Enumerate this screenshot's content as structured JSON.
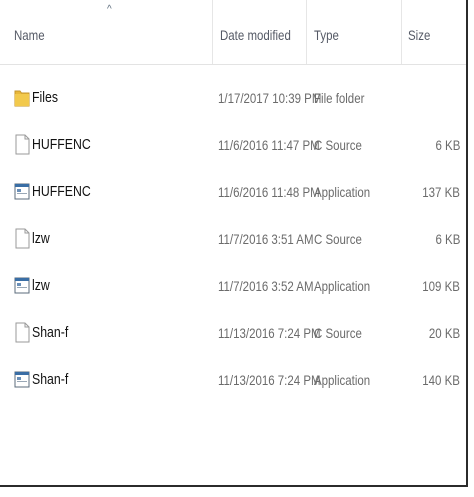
{
  "header": {
    "columns": {
      "name": "Name",
      "date": "Date modified",
      "type": "Type",
      "size": "Size"
    },
    "sort_indicator": "^"
  },
  "files": [
    {
      "name": "Files",
      "date": "1/17/2017 10:39 PM",
      "type": "File folder",
      "size": "",
      "icon": "folder-icon"
    },
    {
      "name": "HUFFENC",
      "date": "11/6/2016 11:47 PM",
      "type": "C Source",
      "size": "6 KB",
      "icon": "c-source-file-icon"
    },
    {
      "name": "HUFFENC",
      "date": "11/6/2016 11:48 PM",
      "type": "Application",
      "size": "137 KB",
      "icon": "application-icon"
    },
    {
      "name": "lzw",
      "date": "11/7/2016 3:51 AM",
      "type": "C Source",
      "size": "6 KB",
      "icon": "c-source-file-icon"
    },
    {
      "name": "lzw",
      "date": "11/7/2016 3:52 AM",
      "type": "Application",
      "size": "109 KB",
      "icon": "application-icon"
    },
    {
      "name": "Shan-f",
      "date": "11/13/2016 7:24 PM",
      "type": "C Source",
      "size": "20 KB",
      "icon": "c-source-file-icon"
    },
    {
      "name": "Shan-f",
      "date": "11/13/2016 7:24 PM",
      "type": "Application",
      "size": "140 KB",
      "icon": "application-icon"
    }
  ]
}
